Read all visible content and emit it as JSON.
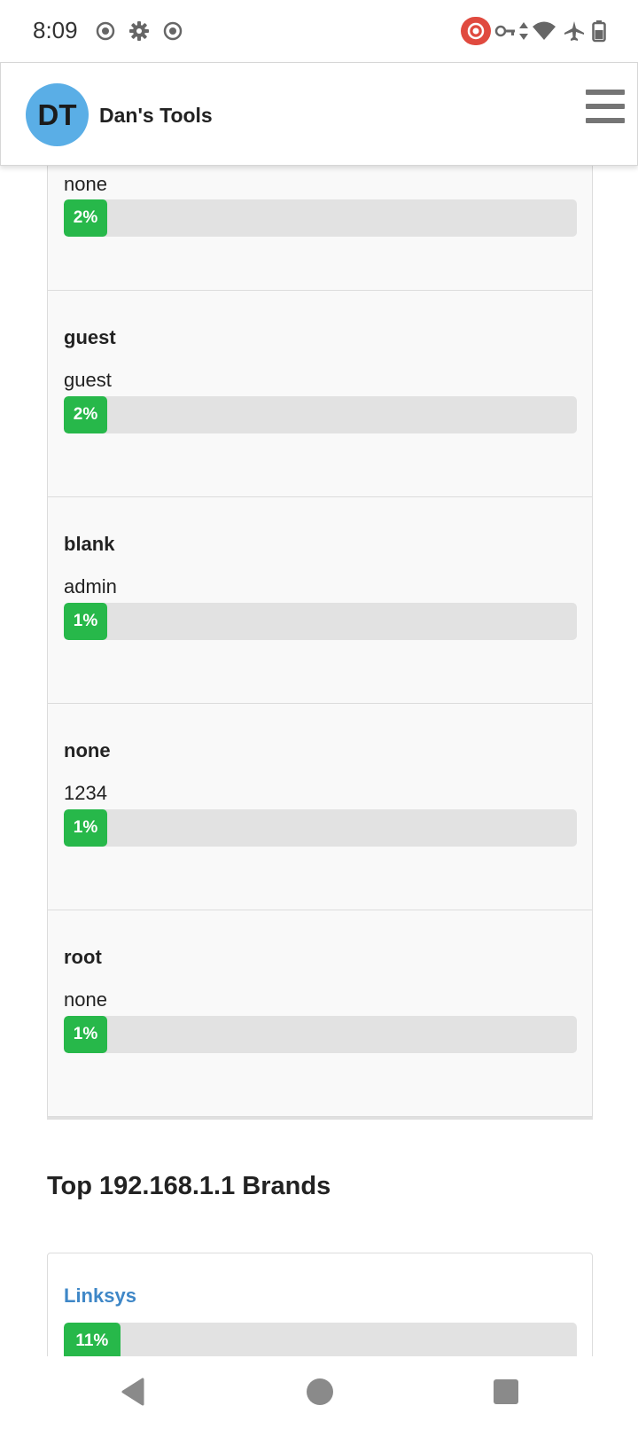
{
  "status_bar": {
    "time": "8:09",
    "left_icons": [
      "screen-record-icon",
      "settings-gear-icon",
      "screen-record-icon"
    ],
    "right_icons": [
      "record-badge-icon",
      "vpn-key-icon",
      "data-arrows-icon",
      "wifi-icon",
      "airplane-icon",
      "battery-icon"
    ],
    "record_badge_color": "#e04a3f"
  },
  "app_bar": {
    "avatar_initials": "DT",
    "avatar_color": "#5aaee6",
    "title": "Dan's Tools",
    "menu_icon": "hamburger-menu-icon"
  },
  "credentials": [
    {
      "username": "",
      "password": "none",
      "percent": 2,
      "percent_label": "2%"
    },
    {
      "username": "guest",
      "password": "guest",
      "percent": 2,
      "percent_label": "2%"
    },
    {
      "username": "blank",
      "password": "admin",
      "percent": 1,
      "percent_label": "1%"
    },
    {
      "username": "none",
      "password": "1234",
      "percent": 1,
      "percent_label": "1%"
    },
    {
      "username": "root",
      "password": "none",
      "percent": 1,
      "percent_label": "1%"
    }
  ],
  "brands_section": {
    "title": "Top 192.168.1.1 Brands",
    "brands": [
      {
        "name": "Linksys",
        "percent": 11,
        "percent_label": "11%"
      }
    ]
  },
  "colors": {
    "bar_fill": "#27b84a",
    "bar_track": "#e2e2e2",
    "brand_link": "#3f87c7"
  },
  "nav_bar": {
    "icons": [
      "back-icon",
      "home-icon",
      "recents-icon"
    ]
  }
}
